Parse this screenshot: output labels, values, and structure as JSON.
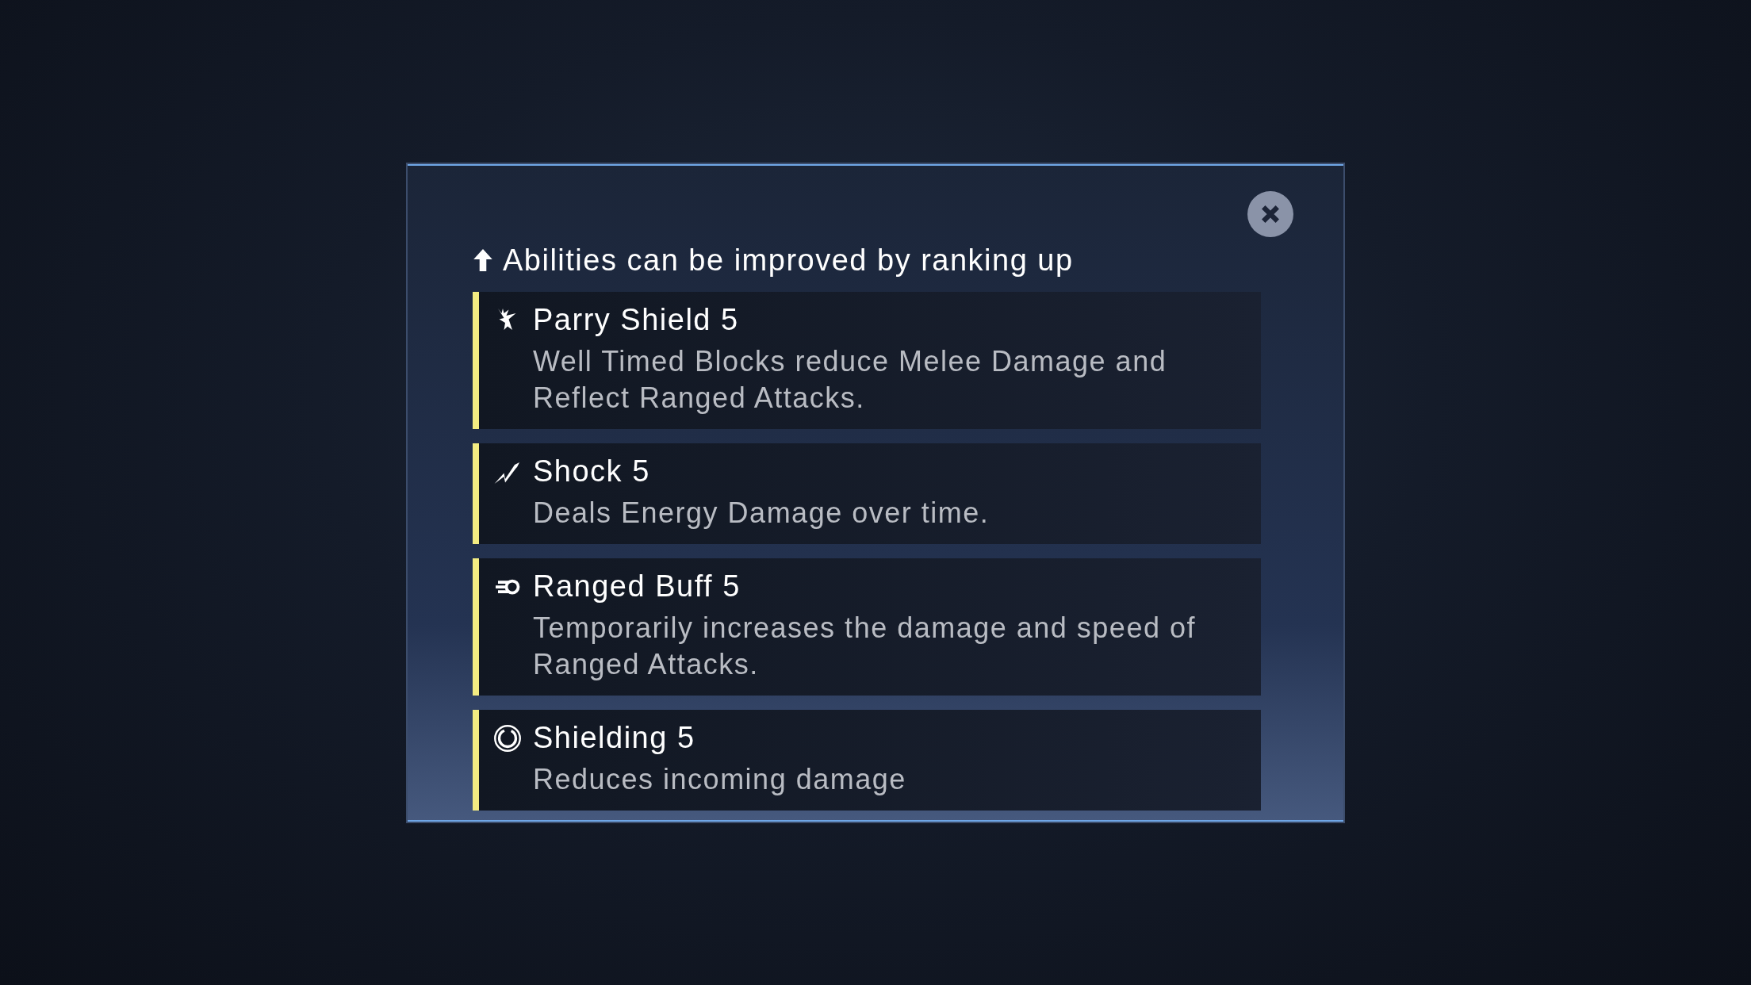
{
  "dialog": {
    "heading": "Abilities can be improved by ranking up",
    "abilities": [
      {
        "kind": "parry",
        "name": "Parry Shield 5",
        "description": "Well Timed Blocks reduce Melee Damage and Reflect Ranged Attacks."
      },
      {
        "kind": "shock",
        "name": "Shock 5",
        "description": "Deals Energy Damage over time."
      },
      {
        "kind": "ranged",
        "name": "Ranged Buff 5",
        "description": "Temporarily increases the damage and speed of Ranged Attacks."
      },
      {
        "kind": "shield",
        "name": "Shielding 5",
        "description": "Reduces incoming damage"
      }
    ]
  }
}
